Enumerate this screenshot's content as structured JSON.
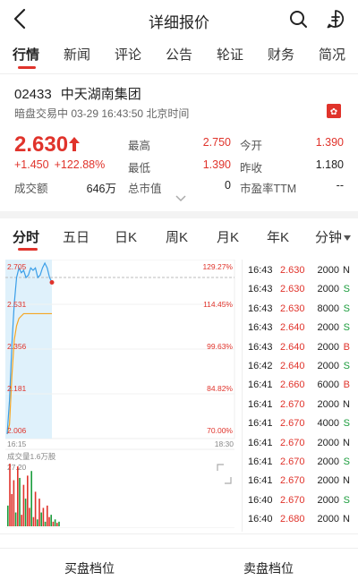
{
  "header": {
    "title": "详细报价",
    "back_icon": "chevron-left-icon",
    "search_icon": "search-icon",
    "chat_icon": "chat-icon"
  },
  "tabs": [
    {
      "label": "行情",
      "active": true
    },
    {
      "label": "新闻"
    },
    {
      "label": "评论"
    },
    {
      "label": "公告"
    },
    {
      "label": "轮证"
    },
    {
      "label": "财务"
    },
    {
      "label": "简况"
    }
  ],
  "stock": {
    "code": "02433",
    "name": "中天湖南集团",
    "status": "暗盘交易中 03-29 16:43:50 北京时间",
    "price": "2.630",
    "change": "+1.450",
    "change_pct": "+122.88%",
    "stats": {
      "high_label": "最高",
      "high": "2.750",
      "open_label": "今开",
      "open": "1.390",
      "low_label": "最低",
      "low": "1.390",
      "prev_label": "昨收",
      "prev": "1.180",
      "amount_label": "成交额",
      "amount": "646万",
      "mktcap_label": "总市值",
      "mktcap": "0",
      "pe_label": "市盈率TTM",
      "pe": "--"
    },
    "accent_color": "#e0332b"
  },
  "kline_tabs": [
    {
      "label": "分时",
      "active": true
    },
    {
      "label": "五日"
    },
    {
      "label": "日K"
    },
    {
      "label": "周K"
    },
    {
      "label": "月K"
    },
    {
      "label": "年K"
    },
    {
      "label": "分钟"
    }
  ],
  "chart": {
    "y_labels": [
      "2.705",
      "2.531",
      "2.356",
      "2.181",
      "2.006"
    ],
    "pct_labels": [
      "129.27%",
      "114.45%",
      "99.63%",
      "84.82%",
      "70.00%"
    ],
    "time_start": "16:15",
    "time_end": "18:30",
    "volume_label": "成交量1.6万股",
    "volume_max": "27.20"
  },
  "chart_data": {
    "type": "line",
    "title": "",
    "xlabel": "",
    "ylabel": "",
    "x_range": [
      "16:15",
      "18:30"
    ],
    "ylim": [
      2.006,
      2.705
    ],
    "series": [
      {
        "values": [
          2.01,
          2.15,
          2.38,
          2.55,
          2.66,
          2.7,
          2.68,
          2.69,
          2.66,
          2.67,
          2.7,
          2.69,
          2.7,
          2.66,
          2.67,
          2.7,
          2.72,
          2.7,
          2.66,
          2.64
        ]
      },
      {
        "values": [
          2.01,
          2.05,
          2.25,
          2.4,
          2.46,
          2.49,
          2.5,
          2.51,
          2.51,
          2.51,
          2.51,
          2.51,
          2.51,
          2.51,
          2.51,
          2.51,
          2.51,
          2.51,
          2.51,
          2.51
        ]
      }
    ],
    "volume": {
      "max": 27.2,
      "bars": [
        9,
        27.2,
        14,
        20,
        6,
        26,
        21,
        5,
        18,
        12,
        22,
        8,
        24,
        4,
        15,
        3,
        12,
        6,
        8,
        2,
        9,
        4,
        5,
        2,
        3,
        1.5,
        2
      ],
      "colors": [
        "G",
        "R",
        "R",
        "R",
        "G",
        "R",
        "G",
        "R",
        "R",
        "G",
        "R",
        "R",
        "G",
        "R",
        "R",
        "G",
        "R",
        "G",
        "R",
        "G",
        "R",
        "R",
        "G",
        "R",
        "G",
        "R",
        "G"
      ]
    }
  },
  "trades": [
    {
      "time": "16:43",
      "price": "2.630",
      "qty": "2000",
      "side": "N"
    },
    {
      "time": "16:43",
      "price": "2.630",
      "qty": "2000",
      "side": "S"
    },
    {
      "time": "16:43",
      "price": "2.630",
      "qty": "8000",
      "side": "S"
    },
    {
      "time": "16:43",
      "price": "2.640",
      "qty": "2000",
      "side": "S"
    },
    {
      "time": "16:43",
      "price": "2.640",
      "qty": "2000",
      "side": "B"
    },
    {
      "time": "16:42",
      "price": "2.640",
      "qty": "2000",
      "side": "S"
    },
    {
      "time": "16:41",
      "price": "2.660",
      "qty": "6000",
      "side": "B"
    },
    {
      "time": "16:41",
      "price": "2.670",
      "qty": "2000",
      "side": "N"
    },
    {
      "time": "16:41",
      "price": "2.670",
      "qty": "4000",
      "side": "S"
    },
    {
      "time": "16:41",
      "price": "2.670",
      "qty": "2000",
      "side": "N"
    },
    {
      "time": "16:41",
      "price": "2.670",
      "qty": "2000",
      "side": "S"
    },
    {
      "time": "16:41",
      "price": "2.670",
      "qty": "2000",
      "side": "N"
    },
    {
      "time": "16:40",
      "price": "2.670",
      "qty": "2000",
      "side": "S"
    },
    {
      "time": "16:40",
      "price": "2.680",
      "qty": "2000",
      "side": "N"
    }
  ],
  "footer": {
    "buy_label": "买盘档位",
    "sell_label": "卖盘档位"
  }
}
